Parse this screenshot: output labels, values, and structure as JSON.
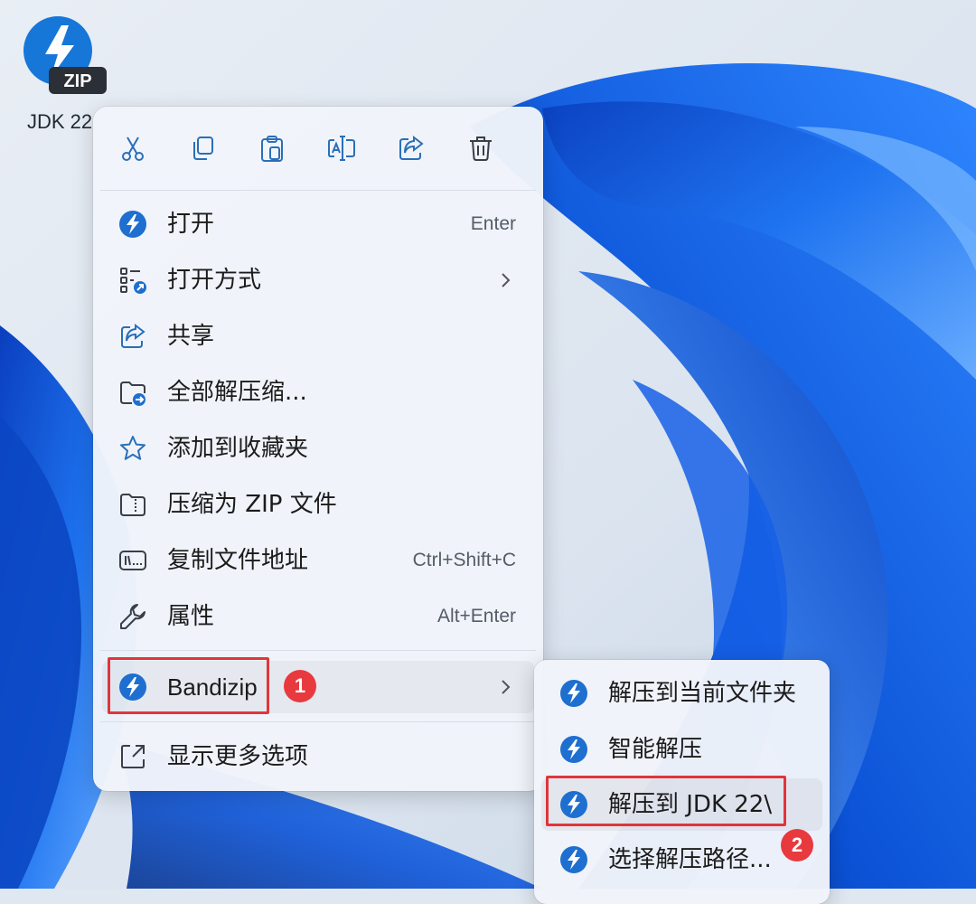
{
  "desktop": {
    "file_icon": "zip-archive-icon",
    "file_badge": "ZIP",
    "file_name": "JDK 22"
  },
  "toolbar": [
    {
      "name": "cut",
      "icon": "scissors-icon"
    },
    {
      "name": "copy",
      "icon": "copy-icon"
    },
    {
      "name": "paste",
      "icon": "clipboard-icon"
    },
    {
      "name": "rename",
      "icon": "rename-icon"
    },
    {
      "name": "share",
      "icon": "share-icon"
    },
    {
      "name": "delete",
      "icon": "trash-icon"
    }
  ],
  "menu": {
    "items": [
      {
        "label": "打开",
        "shortcut": "Enter",
        "icon": "bandizip-icon"
      },
      {
        "label": "打开方式",
        "shortcut": "",
        "icon": "open-with-icon",
        "submenu": true
      },
      {
        "label": "共享",
        "shortcut": "",
        "icon": "share-icon"
      },
      {
        "label": "全部解压缩...",
        "shortcut": "",
        "icon": "extract-folder-icon"
      },
      {
        "label": "添加到收藏夹",
        "shortcut": "",
        "icon": "star-icon"
      },
      {
        "label": "压缩为 ZIP 文件",
        "shortcut": "",
        "icon": "zip-folder-icon"
      },
      {
        "label": "复制文件地址",
        "shortcut": "Ctrl+Shift+C",
        "icon": "path-icon"
      },
      {
        "label": "属性",
        "shortcut": "Alt+Enter",
        "icon": "wrench-icon"
      }
    ],
    "bandizip": {
      "label": "Bandizip",
      "icon": "bandizip-icon",
      "submenu": true
    },
    "more": {
      "label": "显示更多选项",
      "icon": "show-more-icon"
    }
  },
  "submenu": {
    "items": [
      {
        "label": "解压到当前文件夹",
        "icon": "bandizip-icon"
      },
      {
        "label": "智能解压",
        "icon": "bandizip-icon"
      },
      {
        "label": "解压到 JDK 22\\",
        "icon": "bandizip-icon"
      },
      {
        "label": "选择解压路径...",
        "icon": "bandizip-icon"
      }
    ]
  },
  "annotations": {
    "step1": "1",
    "step2": "2",
    "color": "#e0353b"
  },
  "colors": {
    "accent": "#0f6cbd",
    "wallpaper": "#1d6fe0"
  }
}
